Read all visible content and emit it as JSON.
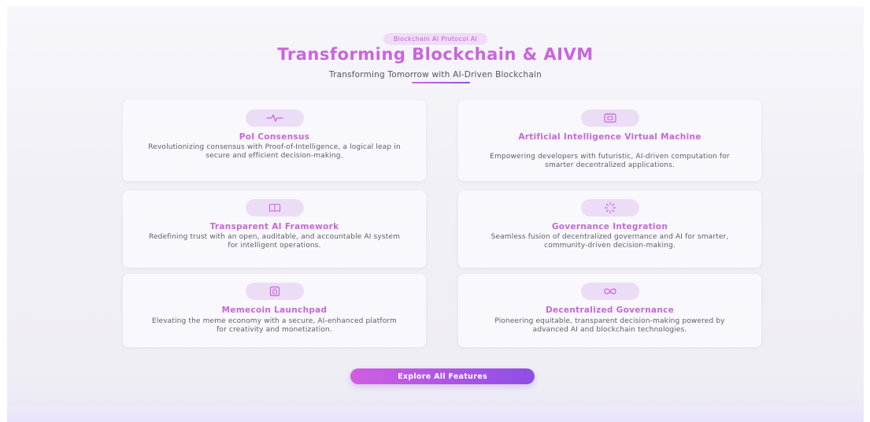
{
  "header": {
    "badge": "Blockchain AI Protocol AI",
    "title": "Transforming Blockchain & AIVM",
    "subtitle": "Transforming Tomorrow with AI-Driven Blockchain"
  },
  "features": [
    {
      "icon": "pulse-icon",
      "title": "PoI Consensus",
      "description": "Revolutionizing consensus with Proof-of-Intelligence, a logical leap in secure and efficient decision-making."
    },
    {
      "icon": "chip-icon",
      "title": "Artificial Intelligence Virtual Machine",
      "description": "Empowering developers with futuristic, AI-driven computation for smarter decentralized applications."
    },
    {
      "icon": "book-icon",
      "title": "Transparent AI Framework",
      "description": "Redefining trust with an open, auditable, and accountable AI system for intelligent operations."
    },
    {
      "icon": "loader-icon",
      "title": "Governance Integration",
      "description": "Seamless fusion of decentralized governance and AI for smarter, community-driven decision-making."
    },
    {
      "icon": "wallet-icon",
      "title": "Memecoin Launchpad",
      "description": "Elevating the meme economy with a secure, AI-enhanced platform for creativity and monetization."
    },
    {
      "icon": "infinity-icon",
      "title": "Decentralized Governance",
      "description": "Pioneering equitable, transparent decision-making powered by advanced AI and blockchain technologies."
    }
  ],
  "cta": {
    "label": "Explore All Features"
  },
  "colors": {
    "accent": "#c965dd",
    "accent_end": "#8d4fe6",
    "icon_bg": "#ecddf7",
    "card_bg": "#f9f8fc"
  }
}
